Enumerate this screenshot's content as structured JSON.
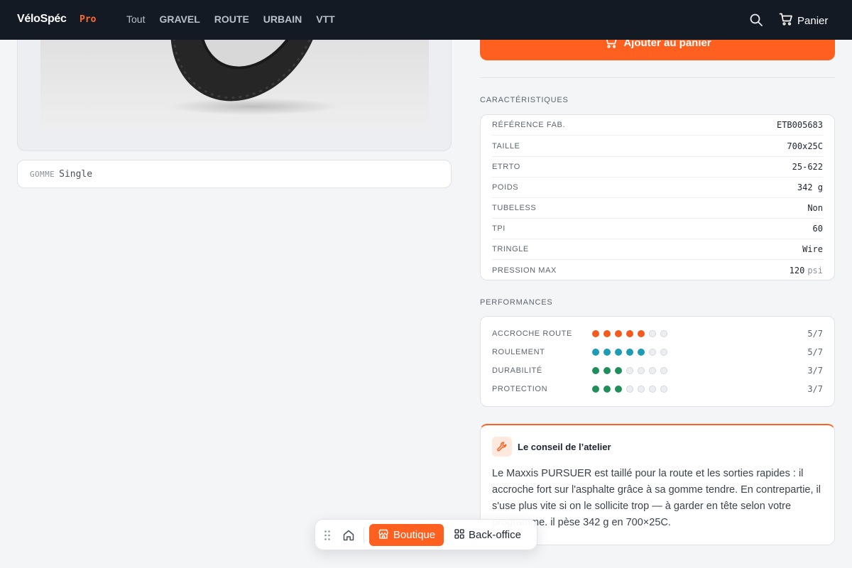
{
  "brand": {
    "name": "VéloSpéc",
    "tag": "Pro"
  },
  "nav": {
    "items": [
      "Tout",
      "GRAVEL",
      "ROUTE",
      "URBAIN",
      "VTT"
    ]
  },
  "header": {
    "cart_label": "Panier"
  },
  "product": {
    "gomme_label": "GOMME",
    "gomme_value": "Single",
    "add_to_cart_label": "Ajouter au panier"
  },
  "specs": {
    "title": "CARACTÉRISTIQUES",
    "rows": [
      {
        "key": "RÉFÉRENCE FAB.",
        "value": "ETB005683",
        "unit": ""
      },
      {
        "key": "TAILLE",
        "value": "700x25C",
        "unit": ""
      },
      {
        "key": "ETRTO",
        "value": "25-622",
        "unit": ""
      },
      {
        "key": "POIDS",
        "value": "342 g",
        "unit": ""
      },
      {
        "key": "TUBELESS",
        "value": "Non",
        "unit": ""
      },
      {
        "key": "TPI",
        "value": "60",
        "unit": ""
      },
      {
        "key": "TRINGLE",
        "value": "Wire",
        "unit": ""
      },
      {
        "key": "PRESSION MAX",
        "value": "120",
        "unit": "psi"
      }
    ]
  },
  "performance": {
    "title": "PERFORMANCES",
    "max": 7,
    "rows": [
      {
        "key": "ACCROCHE ROUTE",
        "score": 5,
        "label": "5/7",
        "color": "#f25a1f"
      },
      {
        "key": "ROULEMENT",
        "score": 5,
        "label": "5/7",
        "color": "#1b9bb4"
      },
      {
        "key": "DURABILITÉ",
        "score": 3,
        "label": "3/7",
        "color": "#1e8e5a"
      },
      {
        "key": "PROTECTION",
        "score": 3,
        "label": "3/7",
        "color": "#1e8e5a"
      }
    ]
  },
  "advice": {
    "title": "Le conseil de l’atelier",
    "text": "Le Maxxis PURSUER est taillé pour la route et les sorties rapides : il accroche fort sur l'asphalte grâce à sa gomme tendre. En contrepartie, il s'use plus vite si on le sollicite trop — à garder en tête selon votre programme. il pèse 342 g en 700×25C."
  },
  "dock": {
    "shop_label": "Boutique",
    "backoffice_label": "Back-office"
  },
  "colors": {
    "accent": "#ff5f1f",
    "topbar": "#131a23"
  }
}
